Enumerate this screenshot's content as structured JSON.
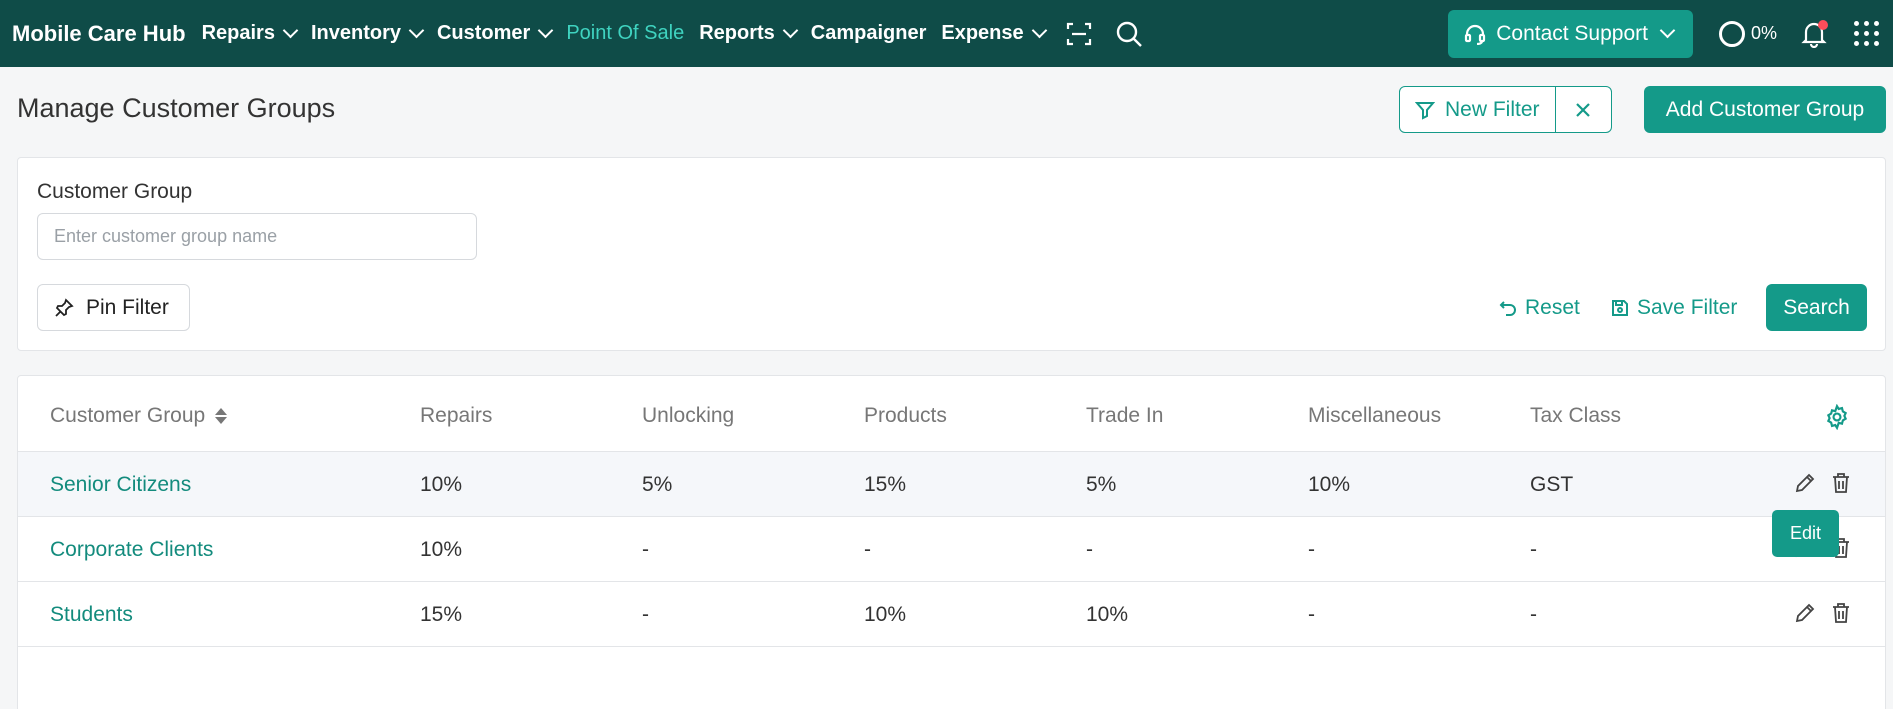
{
  "brand": "Mobile Care Hub",
  "nav": {
    "items": [
      {
        "label": "Repairs",
        "dropdown": true,
        "active": false
      },
      {
        "label": "Inventory",
        "dropdown": true,
        "active": false
      },
      {
        "label": "Customer",
        "dropdown": true,
        "active": false
      },
      {
        "label": "Point Of Sale",
        "dropdown": false,
        "active": true
      },
      {
        "label": "Reports",
        "dropdown": true,
        "active": false
      },
      {
        "label": "Campaigner",
        "dropdown": false,
        "active": false
      },
      {
        "label": "Expense",
        "dropdown": true,
        "active": false
      }
    ],
    "contact_support": "Contact Support",
    "progress": "0%"
  },
  "page": {
    "title": "Manage Customer Groups",
    "new_filter": "New Filter",
    "add_group": "Add Customer Group"
  },
  "filter": {
    "label": "Customer Group",
    "placeholder": "Enter customer group name",
    "value": "",
    "pin": "Pin Filter",
    "reset": "Reset",
    "save": "Save Filter",
    "search": "Search"
  },
  "table": {
    "columns": [
      "Customer Group",
      "Repairs",
      "Unlocking",
      "Products",
      "Trade In",
      "Miscellaneous",
      "Tax Class"
    ],
    "rows": [
      [
        "Senior Citizens",
        "10%",
        "5%",
        "15%",
        "5%",
        "10%",
        "GST"
      ],
      [
        "Corporate Clients",
        "10%",
        "-",
        "-",
        "-",
        "-",
        "-"
      ],
      [
        "Students",
        "15%",
        "-",
        "10%",
        "10%",
        "-",
        "-"
      ]
    ]
  },
  "tooltip": "Edit",
  "colors": {
    "nav_bg": "#0f4c48",
    "accent": "#149a89",
    "nav_active": "#3fd3c0",
    "notification": "#ff4d5a"
  }
}
